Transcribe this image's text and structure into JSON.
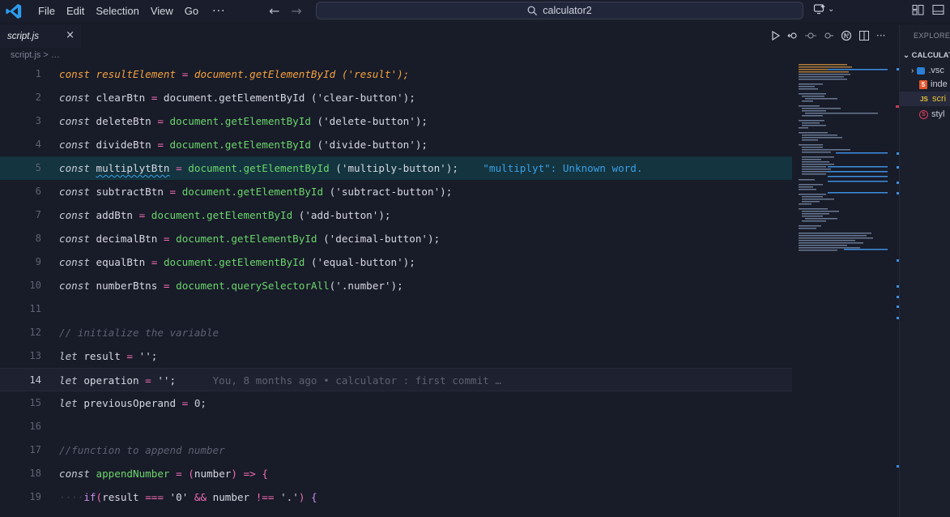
{
  "titlebar": {
    "menu": [
      "File",
      "Edit",
      "Selection",
      "View",
      "Go"
    ],
    "more": "···",
    "search_text": "calculator2"
  },
  "tab": {
    "label": "script.js",
    "close": "×"
  },
  "breadcrumb": "script.js > …",
  "editor": {
    "line_numbers": [
      "1",
      "2",
      "3",
      "4",
      "5",
      "6",
      "7",
      "8",
      "9",
      "10",
      "11",
      "12",
      "13",
      "14",
      "15",
      "16",
      "17",
      "18",
      "19"
    ],
    "diagnostic": "\"multiplyt\": Unknown word.",
    "blame": "You, 8 months ago • calculator : first commit …"
  },
  "explorer": {
    "title": "EXPLORER",
    "folder": "CALCULATOR",
    "items": [
      ".vsc",
      "inde",
      "scri",
      "styl"
    ]
  },
  "colors": {
    "accent": "#f4a23f",
    "string_green": "#6bd66d",
    "operator": "#f06eb4",
    "info": "#39a0e8"
  }
}
